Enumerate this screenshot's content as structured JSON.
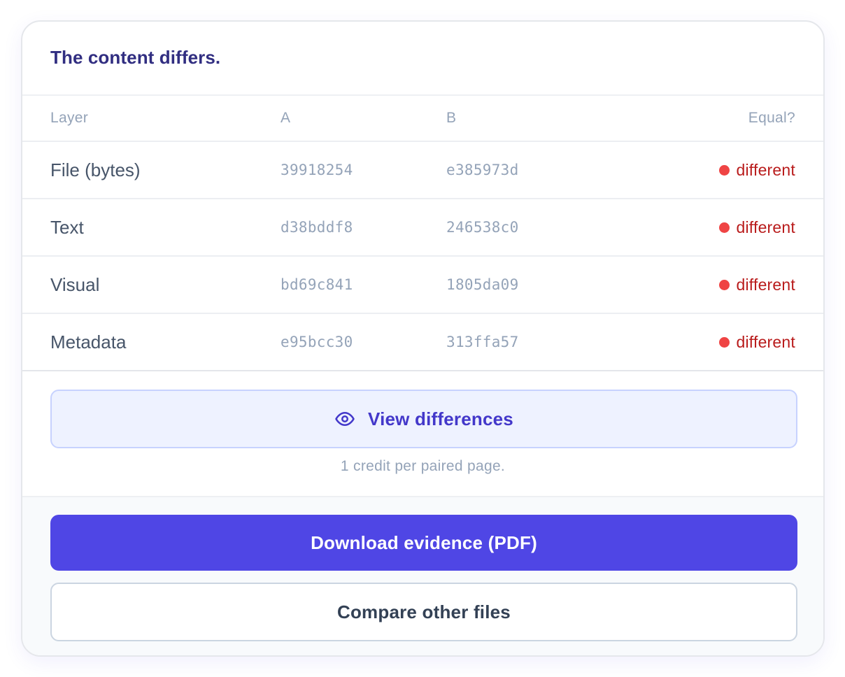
{
  "header": {
    "title": "The content differs."
  },
  "table": {
    "columns": {
      "layer": "Layer",
      "a": "A",
      "b": "B",
      "equal": "Equal?"
    },
    "rows": [
      {
        "layer": "File (bytes)",
        "a": "39918254",
        "b": "e385973d",
        "status": "different"
      },
      {
        "layer": "Text",
        "a": "d38bddf8",
        "b": "246538c0",
        "status": "different"
      },
      {
        "layer": "Visual",
        "a": "bd69c841",
        "b": "1805da09",
        "status": "different"
      },
      {
        "layer": "Metadata",
        "a": "e95bcc30",
        "b": "313ffa57",
        "status": "different"
      }
    ],
    "status_color": "#ef4444"
  },
  "view": {
    "button_label": "View differences",
    "icon": "eye-icon",
    "note": "1 credit per paired page."
  },
  "footer": {
    "download_label": "Download evidence (PDF)",
    "compare_label": "Compare other files"
  },
  "colors": {
    "accent": "#4f46e5",
    "title": "#312e81",
    "danger": "#b91c1c"
  }
}
